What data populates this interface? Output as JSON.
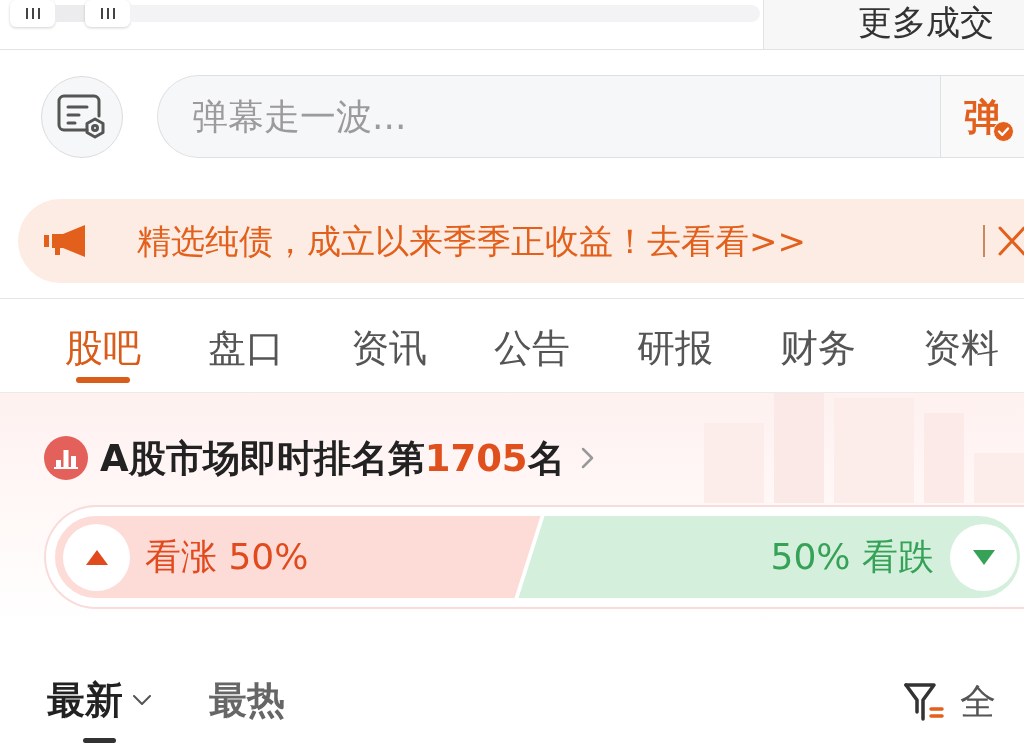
{
  "trade_bar": {
    "more_label": "更多成交"
  },
  "danmaku": {
    "placeholder": "弹幕走一波...",
    "send_label": "弹"
  },
  "promo": {
    "text": "精选纯债，成立以来季季正收益！去看看>>"
  },
  "tabs": [
    {
      "label": "股吧",
      "selected": true
    },
    {
      "label": "盘口",
      "selected": false
    },
    {
      "label": "资讯",
      "selected": false
    },
    {
      "label": "公告",
      "selected": false
    },
    {
      "label": "研报",
      "selected": false
    },
    {
      "label": "财务",
      "selected": false
    },
    {
      "label": "资料",
      "selected": false
    }
  ],
  "ranking": {
    "prefix": "A股市场即时排名第",
    "rank": "1705",
    "suffix": "名"
  },
  "sentiment": {
    "bull_text": "看涨 50%",
    "bear_text": "50% 看跌",
    "level": 0.5
  },
  "feed_tabs": [
    {
      "label": "最新",
      "selected": true,
      "dropdown": true
    },
    {
      "label": "最热",
      "selected": false,
      "dropdown": false
    }
  ],
  "filter": {
    "label": "全"
  }
}
